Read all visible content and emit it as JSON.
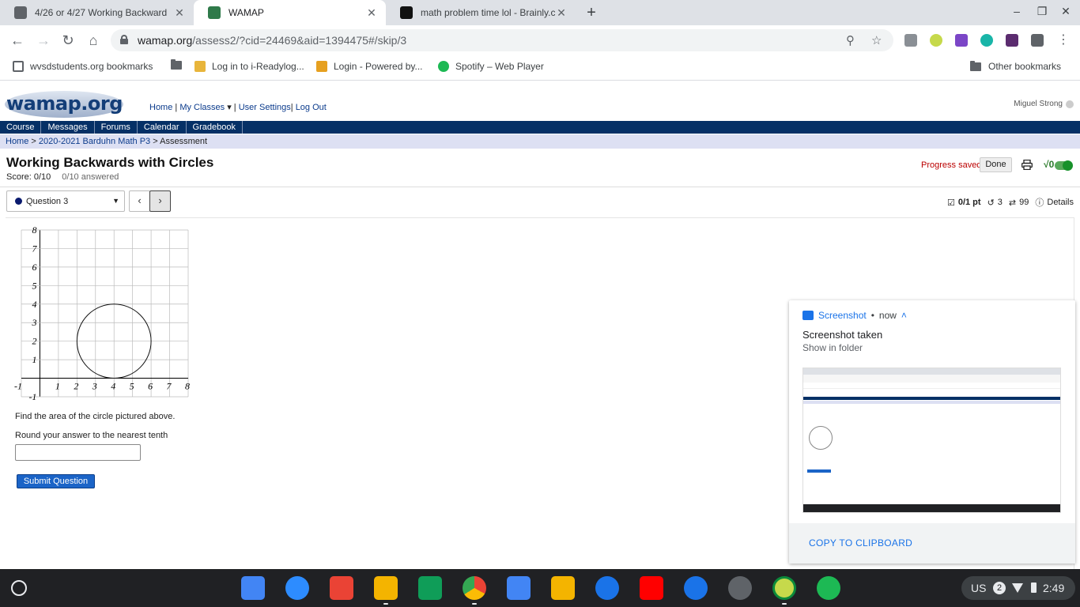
{
  "browser": {
    "tabs": [
      {
        "title": "4/26 or 4/27 Working Backward",
        "active": false
      },
      {
        "title": "WAMAP",
        "active": true
      },
      {
        "title": "math problem time lol - Brainly.c",
        "active": false
      }
    ],
    "url_host": "wamap.org",
    "url_path": "/assess2/?cid=24469&aid=1394475#/skip/3",
    "bookmarks": [
      "wvsdstudents.org bookmarks",
      "Log in to i-Readylog...",
      "Login - Powered by...",
      "Spotify – Web Player"
    ],
    "other_bookmarks": "Other bookmarks"
  },
  "site": {
    "logo": "wamap.org",
    "topnav": {
      "home": "Home",
      "classes": "My Classes",
      "settings": "User Settings",
      "logout": "Log Out"
    },
    "user": "Miguel Strong",
    "menu": [
      "Course",
      "Messages",
      "Forums",
      "Calendar",
      "Gradebook"
    ],
    "breadcrumb": {
      "home": "Home",
      "course": "2020-2021 Barduhn Math P3",
      "current": "Assessment"
    }
  },
  "assessment": {
    "title": "Working Backwards with Circles",
    "score": "Score: 0/10",
    "answered": "0/10 answered",
    "progress": "Progress saved",
    "done": "Done",
    "question_select": "Question 3",
    "points": "0/1 pt",
    "tries": "3",
    "regens": "99",
    "details": "Details",
    "prompt": "Find the area of the circle pictured above.",
    "instruction": "Round your answer to the nearest tenth",
    "answer_value": "",
    "submit": "Submit Question"
  },
  "graph": {
    "x_ticks": [
      "-1",
      "1",
      "2",
      "3",
      "4",
      "5",
      "6",
      "7",
      "8"
    ],
    "y_ticks": [
      "8",
      "7",
      "6",
      "5",
      "4",
      "3",
      "2",
      "1",
      "-1"
    ],
    "xlim": [
      -1,
      8
    ],
    "ylim": [
      -1,
      8
    ],
    "circle": {
      "cx": 4,
      "cy": 2,
      "r": 2
    }
  },
  "notification": {
    "app": "Screenshot",
    "when": "now",
    "title": "Screenshot taken",
    "subtitle": "Show in folder",
    "action": "COPY TO CLIPBOARD"
  },
  "shelf": {
    "ime": "US",
    "ime_badge": "2",
    "time": "2:49"
  }
}
